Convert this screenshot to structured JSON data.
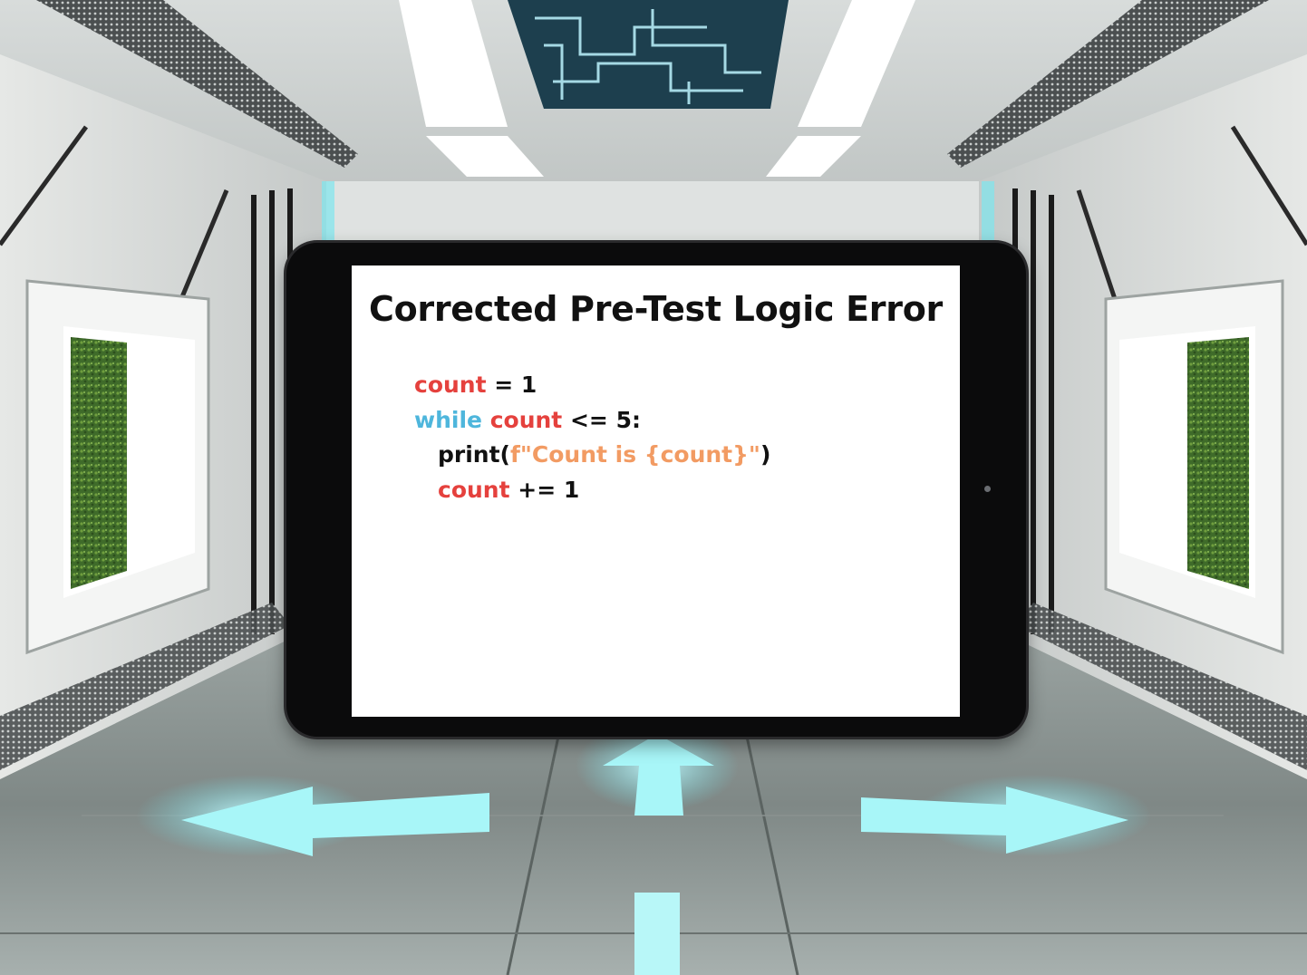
{
  "colors": {
    "variable": "#e5413d",
    "keyword": "#4eb6dc",
    "string": "#f29b63",
    "text": "#111111",
    "floor_arrows": "#9ff3f5"
  },
  "icons": [
    "arrow-left-icon",
    "arrow-up-icon",
    "arrow-right-icon"
  ],
  "slide": {
    "title": "Corrected Pre-Test Logic Error",
    "code": {
      "line1": {
        "var": "count",
        "rest": " = 1"
      },
      "line2": {
        "kw": "while",
        "sp": " ",
        "var": "count",
        "rest": " <= 5:"
      },
      "line3": {
        "fn": "print(",
        "str": "f\"Count is {count}\"",
        "close": ")"
      },
      "line4": {
        "var": "count",
        "rest": " += 1"
      }
    }
  }
}
